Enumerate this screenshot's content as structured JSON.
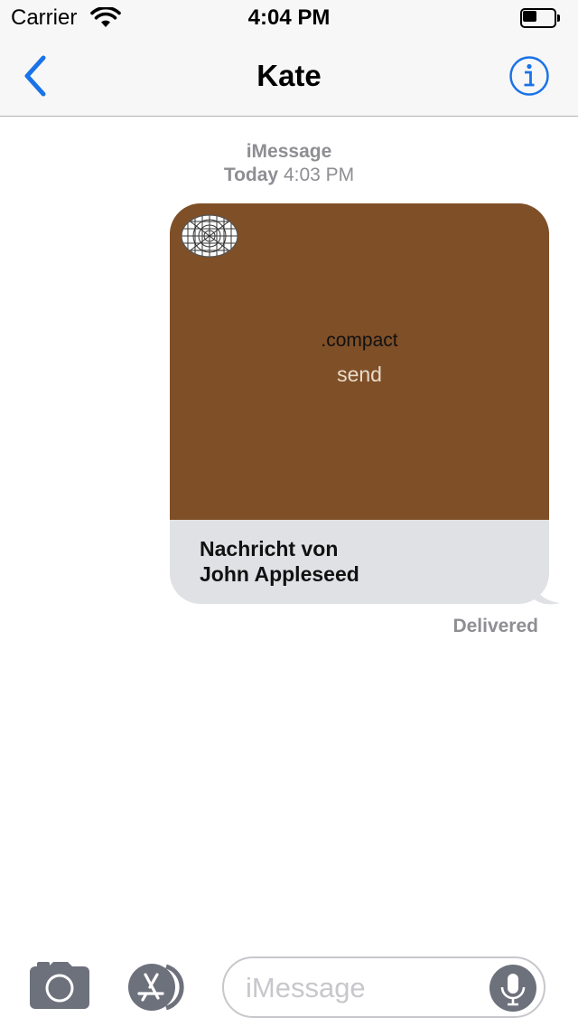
{
  "status_bar": {
    "carrier": "Carrier",
    "time": "4:04 PM",
    "battery_level": 0.5
  },
  "nav": {
    "title": "Kate"
  },
  "conversation": {
    "service": "iMessage",
    "day": "Today",
    "time": "4:03 PM",
    "message": {
      "media_line1": ".compact",
      "media_line2": "send",
      "caption_line1": "Nachricht von",
      "caption_line2": "John Appleseed",
      "bubble_color": "#7f4f27"
    },
    "status": "Delivered"
  },
  "compose": {
    "placeholder": "iMessage"
  },
  "icons": [
    "wifi-icon",
    "battery-icon",
    "back-chevron-icon",
    "info-icon",
    "app-grid-icon",
    "camera-icon",
    "app-store-icon",
    "microphone-icon"
  ]
}
